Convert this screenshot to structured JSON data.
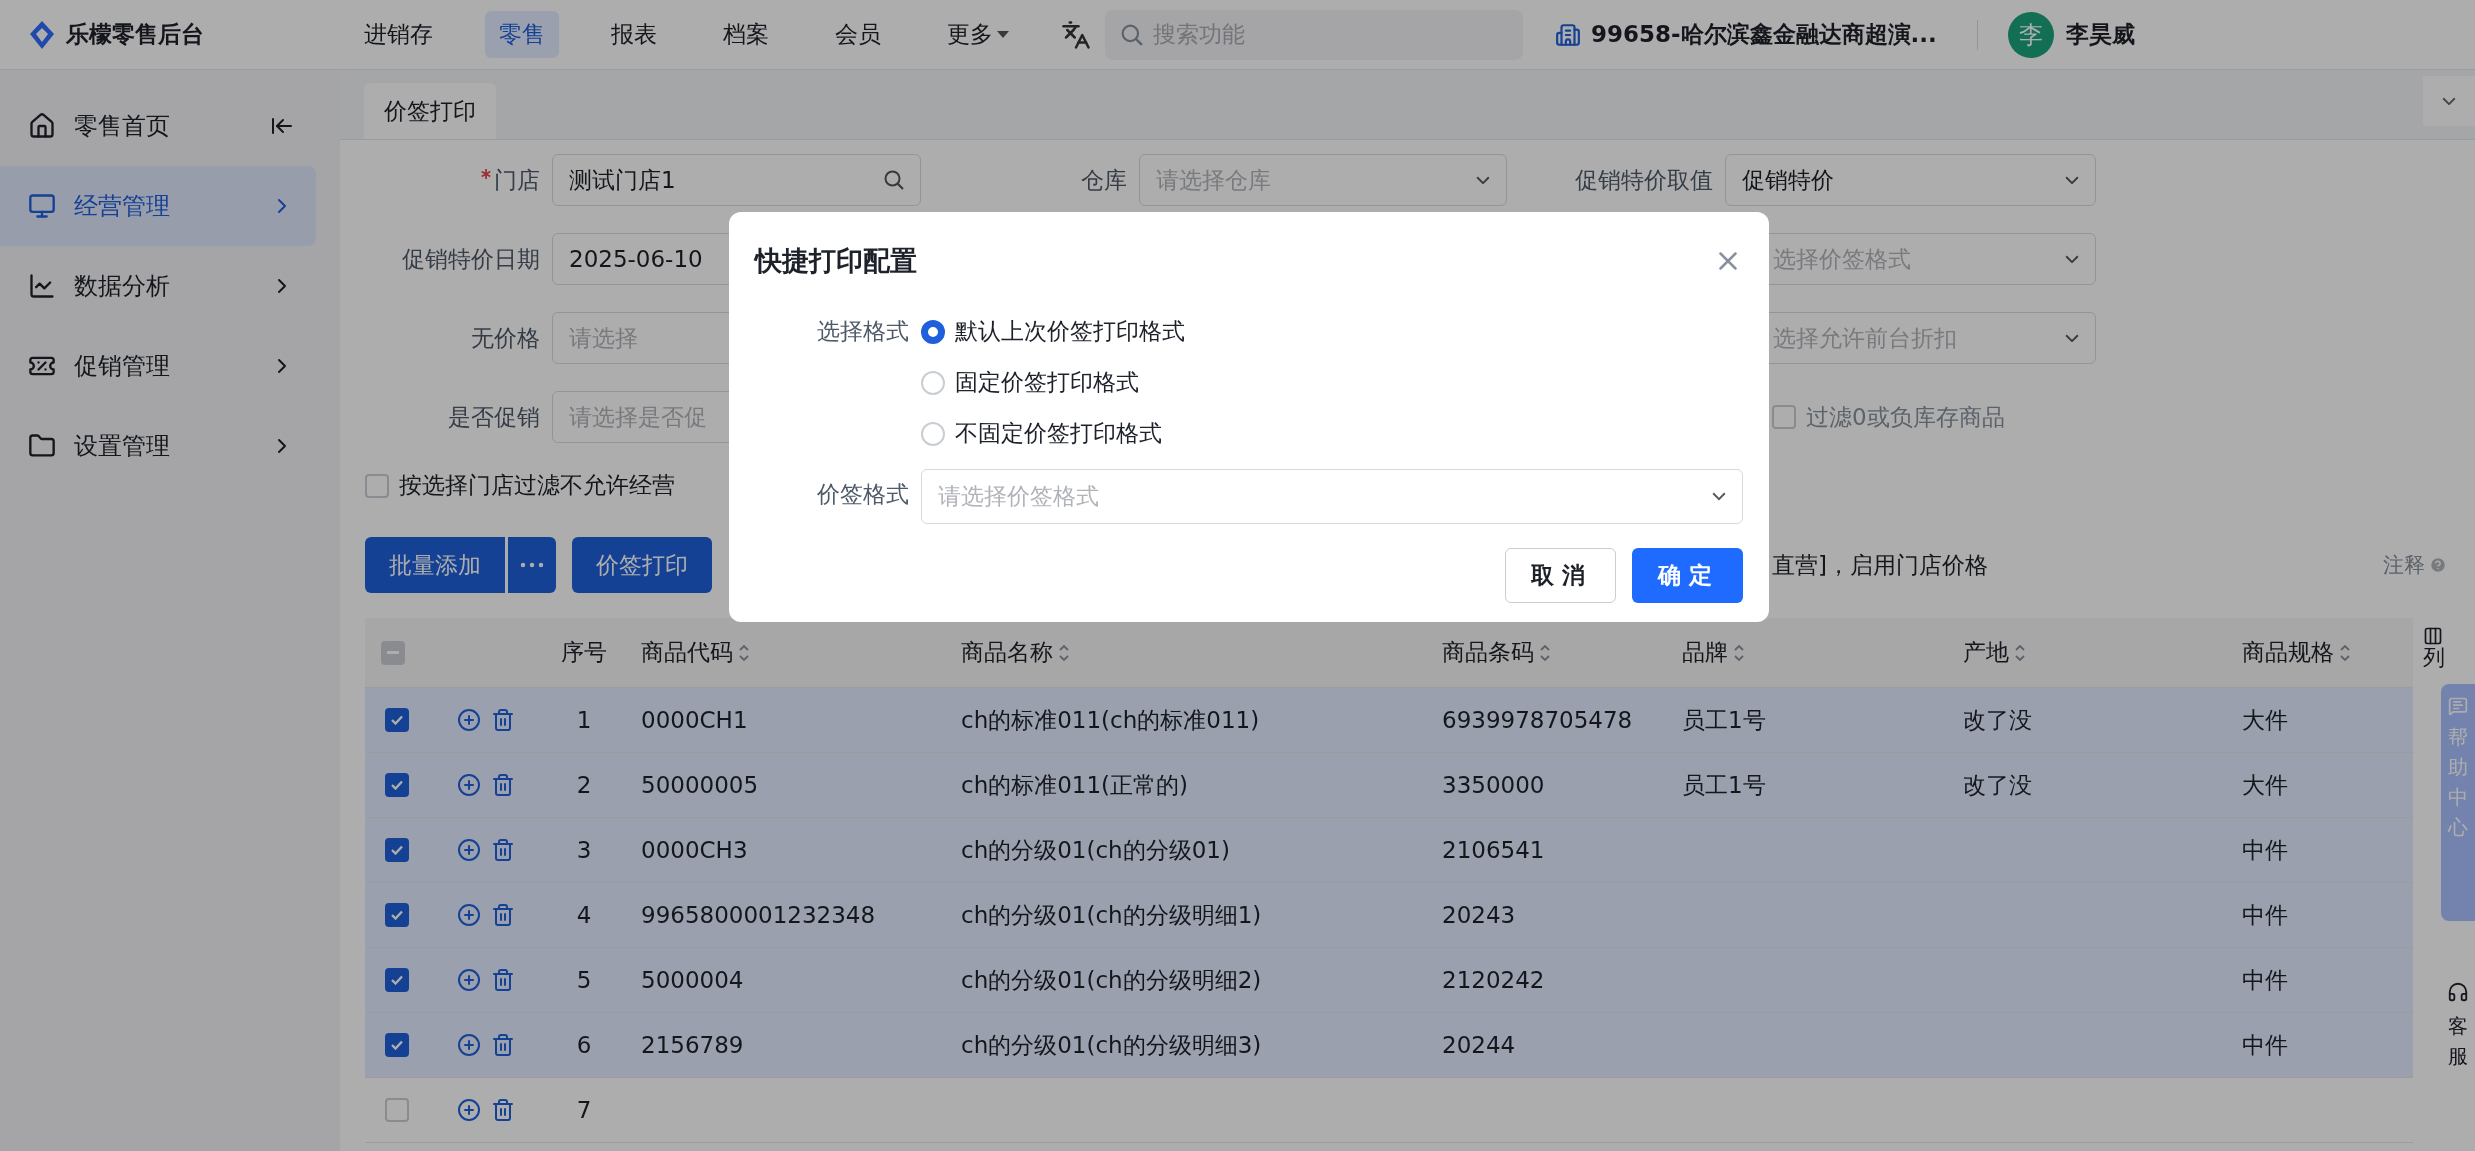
{
  "app": {
    "title": "乐檬零售后台"
  },
  "nav": [
    {
      "label": "进销存",
      "selected": false,
      "has_menu": false
    },
    {
      "label": "零售",
      "selected": true,
      "has_menu": false
    },
    {
      "label": "报表",
      "selected": false,
      "has_menu": false
    },
    {
      "label": "档案",
      "selected": false,
      "has_menu": false
    },
    {
      "label": "会员",
      "selected": false,
      "has_menu": false
    },
    {
      "label": "更多",
      "selected": false,
      "has_menu": true
    }
  ],
  "search": {
    "placeholder": "搜索功能"
  },
  "store": "99658-哈尔滨鑫金融达商超演...",
  "user": {
    "avatar": "李",
    "name": "李昊威"
  },
  "sidebar": {
    "items": [
      {
        "label": "零售首页",
        "selected": false,
        "kind": "home"
      },
      {
        "label": "经营管理",
        "selected": true,
        "kind": "menu"
      },
      {
        "label": "数据分析",
        "selected": false,
        "kind": "menu"
      },
      {
        "label": "促销管理",
        "selected": false,
        "kind": "menu"
      },
      {
        "label": "设置管理",
        "selected": false,
        "kind": "menu"
      }
    ]
  },
  "tabs": [
    {
      "label": "价签打印",
      "selected": true
    }
  ],
  "filters": [
    {
      "left": {
        "kind": "search",
        "label": "门店",
        "required": true,
        "value": "测试门店1"
      },
      "middle": {
        "kind": "select",
        "label": "仓库",
        "required": false,
        "placeholder": "请选择仓库"
      },
      "right": {
        "kind": "select",
        "label": "促销特价取值",
        "required": false,
        "value": "促销特价"
      }
    },
    {
      "left": {
        "kind": "text",
        "label": "促销特价日期",
        "required": false,
        "value": "2025-06-10"
      },
      "right": {
        "kind": "select",
        "placeholder": "选择价签格式"
      }
    },
    {
      "left": {
        "kind": "text",
        "label": "无价格",
        "required": false,
        "placeholder": "请选择"
      },
      "right": {
        "kind": "select",
        "placeholder": "选择允许前台折扣"
      }
    },
    {
      "left": {
        "kind": "text",
        "label": "是否促销",
        "required": false,
        "placeholder": "请选择是否促"
      },
      "right": {
        "kind": "checkbox",
        "label": "过滤0或负库存商品",
        "checked": false
      }
    },
    {
      "left": {
        "kind": "checkbox",
        "label": "按选择门店过滤不允许经营",
        "checked": false
      }
    }
  ],
  "toolbar": {
    "buttons": [
      {
        "label": "批量添加",
        "kind": "split"
      },
      {
        "label": "价签打印",
        "kind": "plain"
      }
    ],
    "info": "直营]，启用门店价格",
    "note": "注释"
  },
  "table": {
    "select_all_indeterminate": true,
    "columns": [
      "序号",
      "商品代码",
      "商品名称",
      "商品条码",
      "品牌",
      "产地",
      "商品规格"
    ],
    "settings": "列",
    "rows": [
      {
        "checked": true,
        "cells": [
          "1",
          "0000CH1",
          "ch的标准011(ch的标准011)",
          "6939978705478",
          "员工1号",
          "改了没",
          "大件"
        ]
      },
      {
        "checked": true,
        "cells": [
          "2",
          "50000005",
          "ch的标准011(正常的)",
          "3350000",
          "员工1号",
          "改了没",
          "大件"
        ]
      },
      {
        "checked": true,
        "cells": [
          "3",
          "0000CH3",
          "ch的分级01(ch的分级01)",
          "2106541",
          "",
          "",
          "中件"
        ]
      },
      {
        "checked": true,
        "cells": [
          "4",
          "9965800001232348",
          "ch的分级01(ch的分级明细1)",
          "20243",
          "",
          "",
          "中件"
        ]
      },
      {
        "checked": true,
        "cells": [
          "5",
          "5000004",
          "ch的分级01(ch的分级明细2)",
          "2120242",
          "",
          "",
          "中件"
        ]
      },
      {
        "checked": true,
        "cells": [
          "6",
          "2156789",
          "ch的分级01(ch的分级明细3)",
          "20244",
          "",
          "",
          "中件"
        ]
      },
      {
        "checked": false,
        "cells": [
          "7",
          "",
          "",
          "",
          "",
          "",
          ""
        ]
      }
    ]
  },
  "side_tools": {
    "help": "帮助中心",
    "service": "客服"
  },
  "dialog": {
    "title": "快捷打印配置",
    "format_label": "选择格式",
    "options": [
      {
        "label": "默认上次价签打印格式",
        "selected": true
      },
      {
        "label": "固定价签打印格式",
        "selected": false
      },
      {
        "label": "不固定价签打印格式",
        "selected": false
      }
    ],
    "template_label": "价签格式",
    "template_placeholder": "请选择价签格式",
    "buttons": [
      {
        "label": "取消",
        "kind": "default"
      },
      {
        "label": "确定",
        "kind": "primary"
      }
    ]
  }
}
